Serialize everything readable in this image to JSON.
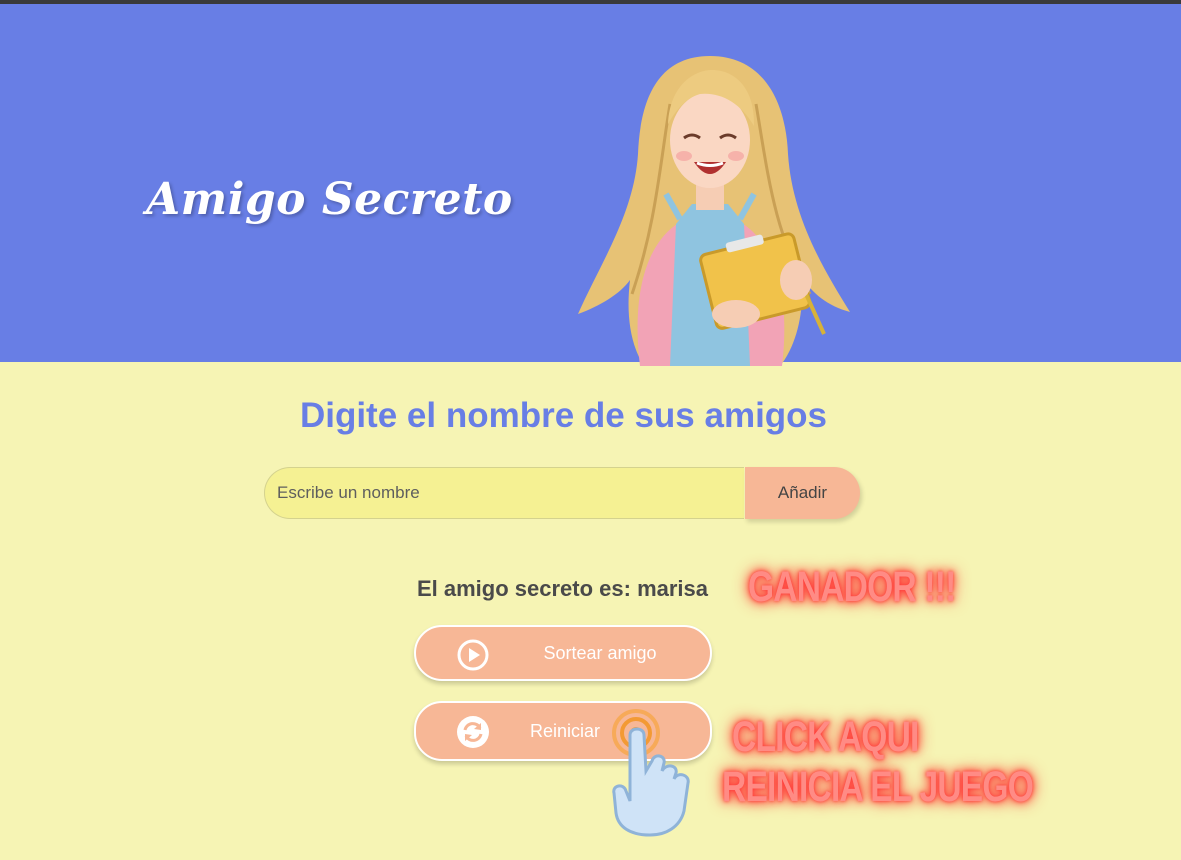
{
  "header": {
    "title": "Amigo Secreto",
    "background_color": "#687ee5",
    "illustration": "girl-holding-clipboard-illustration"
  },
  "main": {
    "background_color": "#f6f4b4",
    "heading": "Digite el nombre de sus amigos",
    "name_input": {
      "placeholder": "Escribe un nombre",
      "value": ""
    },
    "add_button": "Añadir",
    "result_text": "El amigo secreto es: marisa",
    "draw_button": {
      "label": "Sortear amigo",
      "icon": "play-circle-icon"
    },
    "reset_button": {
      "label": "Reiniciar",
      "icon": "refresh-icon"
    }
  },
  "annotations": {
    "winner_text": "GANADOR !!!",
    "click_line1": "CLICK AQUI",
    "click_line2": "REINICIA EL JUEGO",
    "pointer": "pointing-hand-icon",
    "neon_color": "#ff8b85"
  },
  "colors": {
    "accent": "#687ee5",
    "button": "#f7b796",
    "input": "#f5f193"
  }
}
